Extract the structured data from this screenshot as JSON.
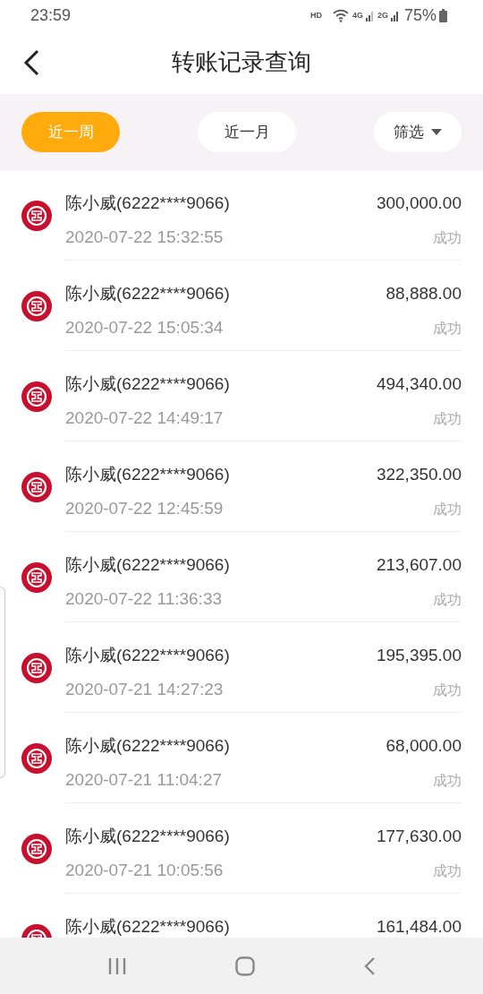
{
  "status_bar": {
    "time": "23:59",
    "hd": "HD",
    "net_1": "4G",
    "net_2": "2G",
    "battery": "75%"
  },
  "header": {
    "title": "转账记录查询"
  },
  "filters": [
    {
      "label": "近一周",
      "kind": "tab",
      "selected": true
    },
    {
      "label": "近一月",
      "kind": "tab",
      "selected": false
    },
    {
      "label": "筛选",
      "kind": "dropdown",
      "selected": false
    }
  ],
  "records": [
    {
      "name": "陈小威(6222****9066)",
      "time": "2020-07-22 15:32:55",
      "amount": "300,000.00",
      "status": "成功"
    },
    {
      "name": "陈小威(6222****9066)",
      "time": "2020-07-22 15:05:34",
      "amount": "88,888.00",
      "status": "成功"
    },
    {
      "name": "陈小威(6222****9066)",
      "time": "2020-07-22 14:49:17",
      "amount": "494,340.00",
      "status": "成功"
    },
    {
      "name": "陈小威(6222****9066)",
      "time": "2020-07-22 12:45:59",
      "amount": "322,350.00",
      "status": "成功"
    },
    {
      "name": "陈小威(6222****9066)",
      "time": "2020-07-22 11:36:33",
      "amount": "213,607.00",
      "status": "成功"
    },
    {
      "name": "陈小威(6222****9066)",
      "time": "2020-07-21 14:27:23",
      "amount": "195,395.00",
      "status": "成功"
    },
    {
      "name": "陈小威(6222****9066)",
      "time": "2020-07-21 11:04:27",
      "amount": "68,000.00",
      "status": "成功"
    },
    {
      "name": "陈小威(6222****9066)",
      "time": "2020-07-21 10:05:56",
      "amount": "177,630.00",
      "status": "成功"
    },
    {
      "name": "陈小威(6222****9066)",
      "amount": "161,484.00"
    }
  ]
}
